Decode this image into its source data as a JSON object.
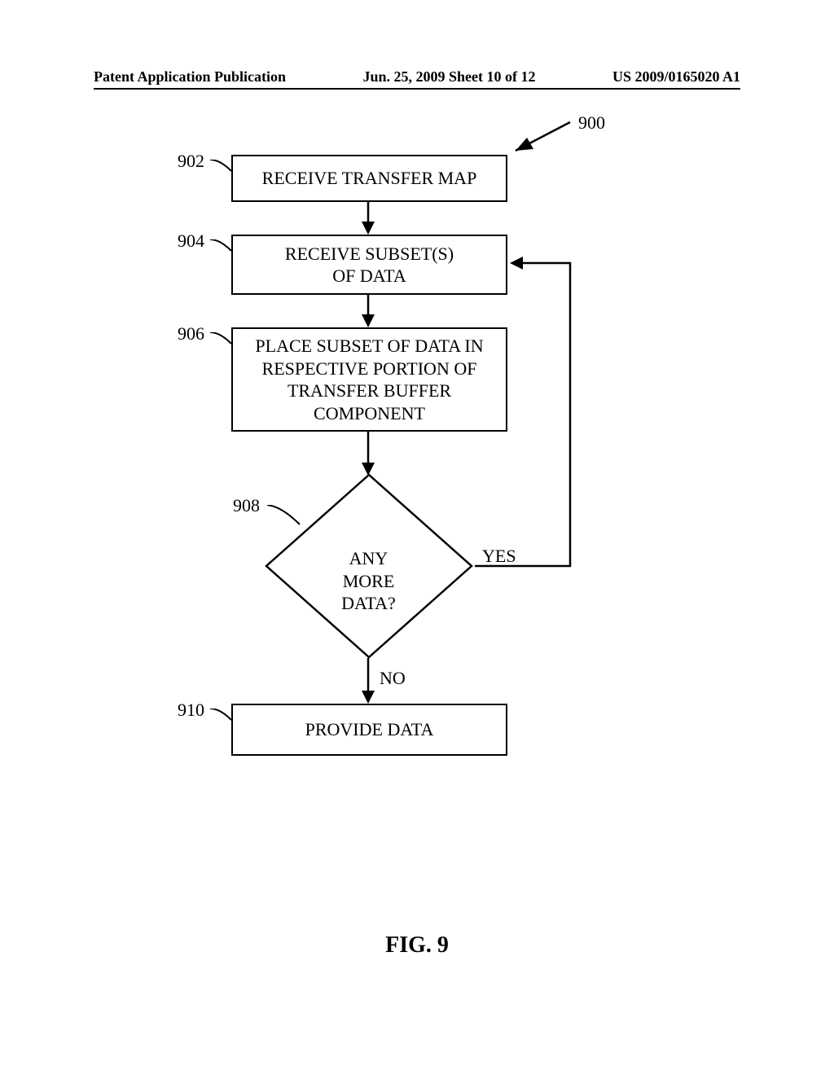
{
  "header": {
    "left": "Patent Application Publication",
    "center": "Jun. 25, 2009  Sheet 10 of 12",
    "right": "US 2009/0165020 A1"
  },
  "refs": {
    "r900": "900",
    "r902": "902",
    "r904": "904",
    "r906": "906",
    "r908": "908",
    "r910": "910"
  },
  "boxes": {
    "b902": "RECEIVE TRANSFER MAP",
    "b904_l1": "RECEIVE SUBSET(S)",
    "b904_l2": "OF DATA",
    "b906_l1": "PLACE SUBSET OF DATA IN",
    "b906_l2": "RESPECTIVE PORTION OF",
    "b906_l3": "TRANSFER BUFFER",
    "b906_l4": "COMPONENT",
    "b908_l1": "ANY MORE",
    "b908_l2": "DATA?",
    "b910": "PROVIDE DATA"
  },
  "branches": {
    "yes": "YES",
    "no": "NO"
  },
  "figure": "FIG. 9"
}
